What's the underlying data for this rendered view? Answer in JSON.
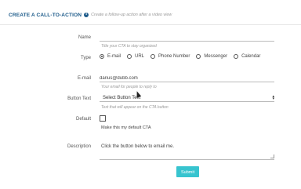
{
  "header": {
    "title": "CREATE A CALL-TO-ACTION",
    "subtitle": "Create a follow-up action after a video view",
    "info_icon": "info-icon"
  },
  "form": {
    "name": {
      "label": "Name",
      "value": "",
      "help": "Title your CTA to stay organized"
    },
    "type": {
      "label": "Type",
      "options": [
        "E-mail",
        "URL",
        "Phone Number",
        "Messenger",
        "Calendar"
      ],
      "selected": "E-mail"
    },
    "email": {
      "label": "E-mail",
      "value": "darius@dubb.com",
      "help": "Your email for people to reply to"
    },
    "button_text": {
      "label": "Button Text",
      "selected_text": "Select Button Text",
      "help": "Text that will appear on the CTA button"
    },
    "default": {
      "label": "Default",
      "checked": false,
      "text": "Make this my default CTA"
    },
    "description": {
      "label": "Description",
      "value": "Click the button below to email me."
    },
    "submit_label": "Submit"
  },
  "colors": {
    "title": "#1d5b8a",
    "submit": "#37c4cf"
  }
}
